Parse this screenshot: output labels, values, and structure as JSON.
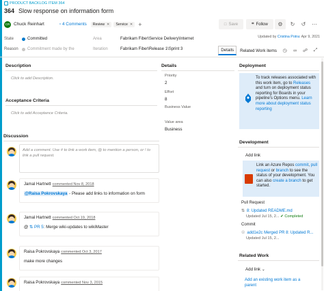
{
  "colors": {
    "accent": "#009ccc",
    "link": "#0078d4",
    "state_committed": "#007acc",
    "info_bg": "#deecf9"
  },
  "work_item": {
    "type_label": "PRODUCT BACKLOG ITEM 364",
    "id": "364",
    "title": "Slow response on information form"
  },
  "header": {
    "assignee_initials": "CR",
    "assignee": "Chuck Reinhart",
    "comments_label": "4 Comments",
    "tags": [
      "Review",
      "Service"
    ],
    "add_tag": "+",
    "save_label": "Save",
    "follow_label": "Follow",
    "updated_prefix": "Updated by ",
    "updated_by": "Cristina Potra",
    "updated_suffix": ": Apr 9, 2021"
  },
  "fields": {
    "state_label": "State",
    "state_value": "Committed",
    "reason_label": "Reason",
    "reason_value": "Commitment made by the",
    "area_label": "Area",
    "area_value": "Fabrikam Fiber\\Service Delivery\\Internet",
    "iteration_label": "Iteration",
    "iteration_value": "Fabrikam Fiber\\Release 1\\Sprint 3"
  },
  "tabs": [
    {
      "label": "Details",
      "active": true
    },
    {
      "label": "Related Work items",
      "active": false
    }
  ],
  "left": {
    "description_title": "Description",
    "description_placeholder": "Click to add Description.",
    "acceptance_title": "Acceptance Criteria",
    "acceptance_placeholder": "Click to add Acceptance Criteria.",
    "discussion_title": "Discussion",
    "comment_placeholder": "Add a comment. Use # to link a work item, @ to mention a person, or ! to link a pull request."
  },
  "details": {
    "title": "Details",
    "priority_label": "Priority",
    "priority_value": "2",
    "effort_label": "Effort",
    "effort_value": "8",
    "business_value_label": "Business Value",
    "business_value_value": "",
    "value_area_label": "Value area",
    "value_area_value": "Business"
  },
  "deployment": {
    "title": "Deployment",
    "text_1": "To track releases associated with this work item, go to ",
    "releases_link": "Releases",
    "text_2": " and turn on deployment status reporting for Boards in your pipeline's Options menu. ",
    "learn_link": "Learn more about deployment status reporting"
  },
  "development": {
    "title": "Development",
    "add_link": "Add link",
    "text_1": "Link an Azure Repos ",
    "commit_link": "commit",
    "pr_link": "pull request",
    "text_2": " or ",
    "branch_link": "branch",
    "text_3": " to see the status of your development. You can also ",
    "create_branch_link": "create a branch",
    "text_4": " to get started.",
    "pull_request_label": "Pull Request",
    "pr_item": "8: Updated README.md",
    "pr_meta": "Updated Jul 15, 2...",
    "pr_status": "Completed",
    "commit_label": "Commit",
    "commit_item": "add1e2c Merged PR 8: Updated R...",
    "commit_meta": "Updated Jul 15, 2..."
  },
  "related": {
    "title": "Related Work",
    "add_link": "Add link",
    "existing_link": "Add an existing work item as a parent"
  },
  "comments": [
    {
      "author": "Jamal Hartnett",
      "when": "commented Nov 8, 2018",
      "mention": "@Raisa Pokrovskaya",
      "body": " - Please add links to information on form"
    },
    {
      "author": "Jamal Hartnett",
      "when": "commented Oct 19, 2018",
      "prefix": "@",
      "pr": "PR 5",
      "body": ": Merge wiki-updates to wikiMaster"
    },
    {
      "author": "Raisa Pokrovskaya",
      "when": "commented Oct 3, 2017",
      "body": "make more changes"
    },
    {
      "author": "Raisa Pokrovskaya",
      "when": "commented Nov 3, 2015",
      "body": ""
    }
  ]
}
